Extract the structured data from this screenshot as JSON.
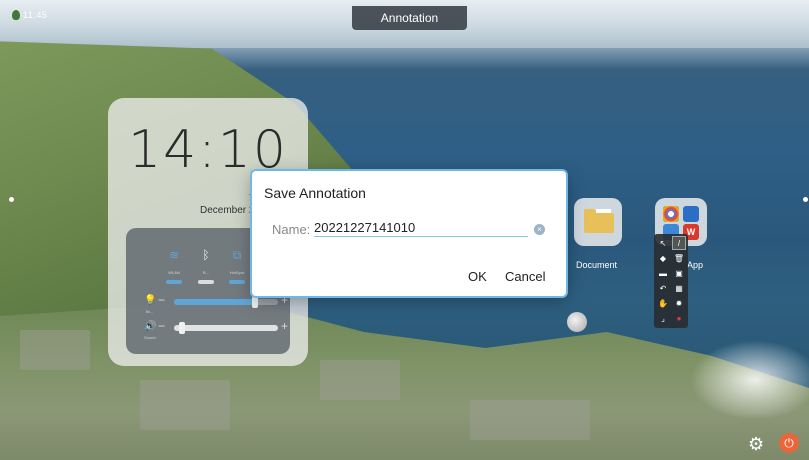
{
  "app": {
    "title": "Annotation",
    "logo_text": "11:45"
  },
  "widget": {
    "time": "14:10",
    "weekday": "T",
    "date": "December 2",
    "toggles": [
      {
        "label": "WLAN",
        "icon": "wifi-icon",
        "glyph": "≋"
      },
      {
        "label": "B...",
        "icon": "bluetooth-icon",
        "glyph": "ᛒ"
      },
      {
        "label": "HotSpot",
        "icon": "hotspot-icon",
        "glyph": "⧉"
      }
    ],
    "brightness": {
      "label": "Br...",
      "icon": "brightness-icon",
      "glyph": "💡",
      "minus": "−",
      "plus": "+",
      "level": 0.78
    },
    "sound": {
      "label": "Sound",
      "icon": "speaker-icon",
      "glyph": "🔊",
      "minus": "−",
      "plus": "+",
      "level": 0.05
    }
  },
  "apps": [
    {
      "name": "Document",
      "icon": "folder-icon"
    },
    {
      "name": "App",
      "icon": "app-group-icon"
    }
  ],
  "dialog": {
    "title": "Save Annotation",
    "name_label": "Name:",
    "name_value": "20221227141010",
    "clear_glyph": "×",
    "ok_label": "OK",
    "cancel_label": "Cancel"
  },
  "toolbar_glyphs": {
    "cursor": "↖",
    "pen": "/",
    "fill": "◆",
    "trash": "🗑",
    "folder": "▬",
    "save": "▣",
    "undo": "↶",
    "grid": "▦",
    "hand": "✋",
    "gear": "✹",
    "resize": "⌟",
    "close": "●"
  },
  "colors": {
    "accent": "#6db8e8",
    "toggle": "#5fa6d8",
    "slider": "#5fa6d8",
    "record": "#e53935"
  },
  "bottom": {
    "settings_glyph": "⚙",
    "power_glyph": "⏻"
  }
}
